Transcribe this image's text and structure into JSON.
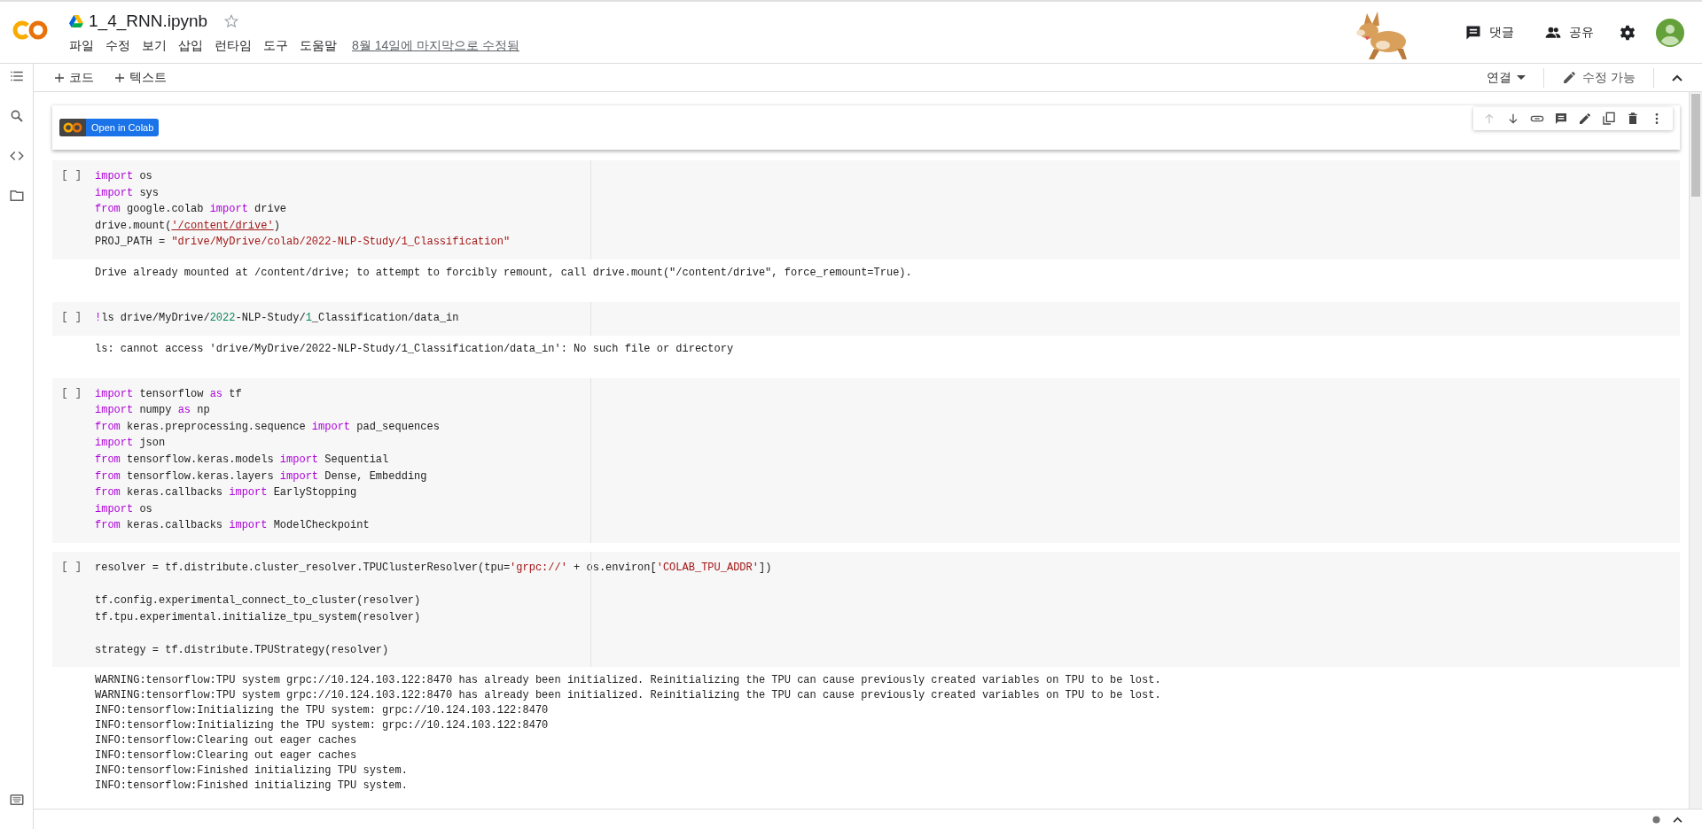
{
  "header": {
    "title": "1_4_RNN.ipynb",
    "starred": false,
    "menus": [
      "파일",
      "수정",
      "보기",
      "삽입",
      "런타임",
      "도구",
      "도움말"
    ],
    "last_edited": "8월 14일에 마지막으로 수정됨",
    "actions": [
      {
        "label": "댓글",
        "kind": "comment"
      },
      {
        "label": "공유",
        "kind": "share"
      }
    ]
  },
  "toolbar": {
    "add_buttons": [
      "코드",
      "텍스트"
    ],
    "connect": "연결",
    "edit_mode": "수정 가능"
  },
  "cells": [
    {
      "kind": "text",
      "badge": "Open in Colab",
      "move_up_disabled": true
    },
    {
      "kind": "code",
      "run_label": "[ ]",
      "lines": [
        {
          "tokens": [
            {
              "text": "import",
              "kind": "keyword"
            },
            {
              "text": " os",
              "kind": "plain"
            }
          ]
        },
        {
          "tokens": [
            {
              "text": "import",
              "kind": "keyword"
            },
            {
              "text": " sys",
              "kind": "plain"
            }
          ]
        },
        {
          "tokens": [
            {
              "text": "from",
              "kind": "keyword"
            },
            {
              "text": " google.colab ",
              "kind": "plain"
            },
            {
              "text": "import",
              "kind": "keyword"
            },
            {
              "text": " drive",
              "kind": "plain"
            }
          ]
        },
        {
          "tokens": [
            {
              "text": "drive.mount(",
              "kind": "plain"
            },
            {
              "text": "'/content/drive'",
              "kind": "link"
            },
            {
              "text": ")",
              "kind": "plain"
            }
          ]
        },
        {
          "tokens": [
            {
              "text": "PROJ_PATH = ",
              "kind": "plain"
            },
            {
              "text": "\"drive/MyDrive/colab/2022-NLP-Study/1_Classification\"",
              "kind": "string"
            }
          ]
        }
      ],
      "output": [
        "Drive already mounted at /content/drive; to attempt to forcibly remount, call drive.mount(\"/content/drive\", force_remount=True)."
      ]
    },
    {
      "kind": "code",
      "run_label": "[ ]",
      "lines": [
        {
          "tokens": [
            {
              "text": "!",
              "kind": "keyword"
            },
            {
              "text": "ls drive/MyDrive/",
              "kind": "plain"
            },
            {
              "text": "2022",
              "kind": "number"
            },
            {
              "text": "-NLP-Study/",
              "kind": "plain"
            },
            {
              "text": "1",
              "kind": "number"
            },
            {
              "text": "_Classification/data_in",
              "kind": "plain"
            }
          ]
        }
      ],
      "output": [
        "ls: cannot access 'drive/MyDrive/2022-NLP-Study/1_Classification/data_in': No such file or directory"
      ]
    },
    {
      "kind": "code",
      "run_label": "[ ]",
      "lines": [
        {
          "tokens": [
            {
              "text": "import",
              "kind": "keyword"
            },
            {
              "text": " tensorflow ",
              "kind": "plain"
            },
            {
              "text": "as",
              "kind": "keyword"
            },
            {
              "text": " tf",
              "kind": "plain"
            }
          ]
        },
        {
          "tokens": [
            {
              "text": "import",
              "kind": "keyword"
            },
            {
              "text": " numpy ",
              "kind": "plain"
            },
            {
              "text": "as",
              "kind": "keyword"
            },
            {
              "text": " np",
              "kind": "plain"
            }
          ]
        },
        {
          "tokens": [
            {
              "text": "from",
              "kind": "keyword"
            },
            {
              "text": " keras.preprocessing.sequence ",
              "kind": "plain"
            },
            {
              "text": "import",
              "kind": "keyword"
            },
            {
              "text": " pad_sequences",
              "kind": "plain"
            }
          ]
        },
        {
          "tokens": [
            {
              "text": "import",
              "kind": "keyword"
            },
            {
              "text": " json",
              "kind": "plain"
            }
          ]
        },
        {
          "tokens": [
            {
              "text": "from",
              "kind": "keyword"
            },
            {
              "text": " tensorflow.keras.models ",
              "kind": "plain"
            },
            {
              "text": "import",
              "kind": "keyword"
            },
            {
              "text": " Sequential",
              "kind": "plain"
            }
          ]
        },
        {
          "tokens": [
            {
              "text": "from",
              "kind": "keyword"
            },
            {
              "text": " tensorflow.keras.layers ",
              "kind": "plain"
            },
            {
              "text": "import",
              "kind": "keyword"
            },
            {
              "text": " Dense, Embedding",
              "kind": "plain"
            }
          ]
        },
        {
          "tokens": [
            {
              "text": "from",
              "kind": "keyword"
            },
            {
              "text": " keras.callbacks ",
              "kind": "plain"
            },
            {
              "text": "import",
              "kind": "keyword"
            },
            {
              "text": " EarlyStopping",
              "kind": "plain"
            }
          ]
        },
        {
          "tokens": [
            {
              "text": "import",
              "kind": "keyword"
            },
            {
              "text": " os",
              "kind": "plain"
            }
          ]
        },
        {
          "tokens": [
            {
              "text": "from",
              "kind": "keyword"
            },
            {
              "text": " keras.callbacks ",
              "kind": "plain"
            },
            {
              "text": "import",
              "kind": "keyword"
            },
            {
              "text": " ModelCheckpoint",
              "kind": "plain"
            }
          ]
        }
      ]
    },
    {
      "kind": "code",
      "run_label": "[ ]",
      "lines": [
        {
          "tokens": [
            {
              "text": "resolver = tf.distribute.cluster_resolver.TPUClusterResolver(tpu=",
              "kind": "plain"
            },
            {
              "text": "'grpc://'",
              "kind": "string"
            },
            {
              "text": " + os.environ[",
              "kind": "plain"
            },
            {
              "text": "'COLAB_TPU_ADDR'",
              "kind": "string"
            },
            {
              "text": "])",
              "kind": "plain"
            }
          ]
        },
        {
          "gap_before": true,
          "tokens": [
            {
              "text": "tf.config.experimental_connect_to_cluster(resolver)",
              "kind": "plain"
            }
          ]
        },
        {
          "tokens": [
            {
              "text": "tf.tpu.experimental.initialize_tpu_system(resolver)",
              "kind": "plain"
            }
          ]
        },
        {
          "gap_before": true,
          "tokens": [
            {
              "text": "strategy = tf.distribute.TPUStrategy(resolver)",
              "kind": "plain"
            }
          ]
        }
      ],
      "output": [
        "WARNING:tensorflow:TPU system grpc://10.124.103.122:8470 has already been initialized. Reinitializing the TPU can cause previously created variables on TPU to be lost.",
        "WARNING:tensorflow:TPU system grpc://10.124.103.122:8470 has already been initialized. Reinitializing the TPU can cause previously created variables on TPU to be lost.",
        "INFO:tensorflow:Initializing the TPU system: grpc://10.124.103.122:8470",
        "INFO:tensorflow:Initializing the TPU system: grpc://10.124.103.122:8470",
        "INFO:tensorflow:Clearing out eager caches",
        "INFO:tensorflow:Clearing out eager caches",
        "INFO:tensorflow:Finished initializing TPU system.",
        "INFO:tensorflow:Finished initializing TPU system."
      ]
    }
  ]
}
